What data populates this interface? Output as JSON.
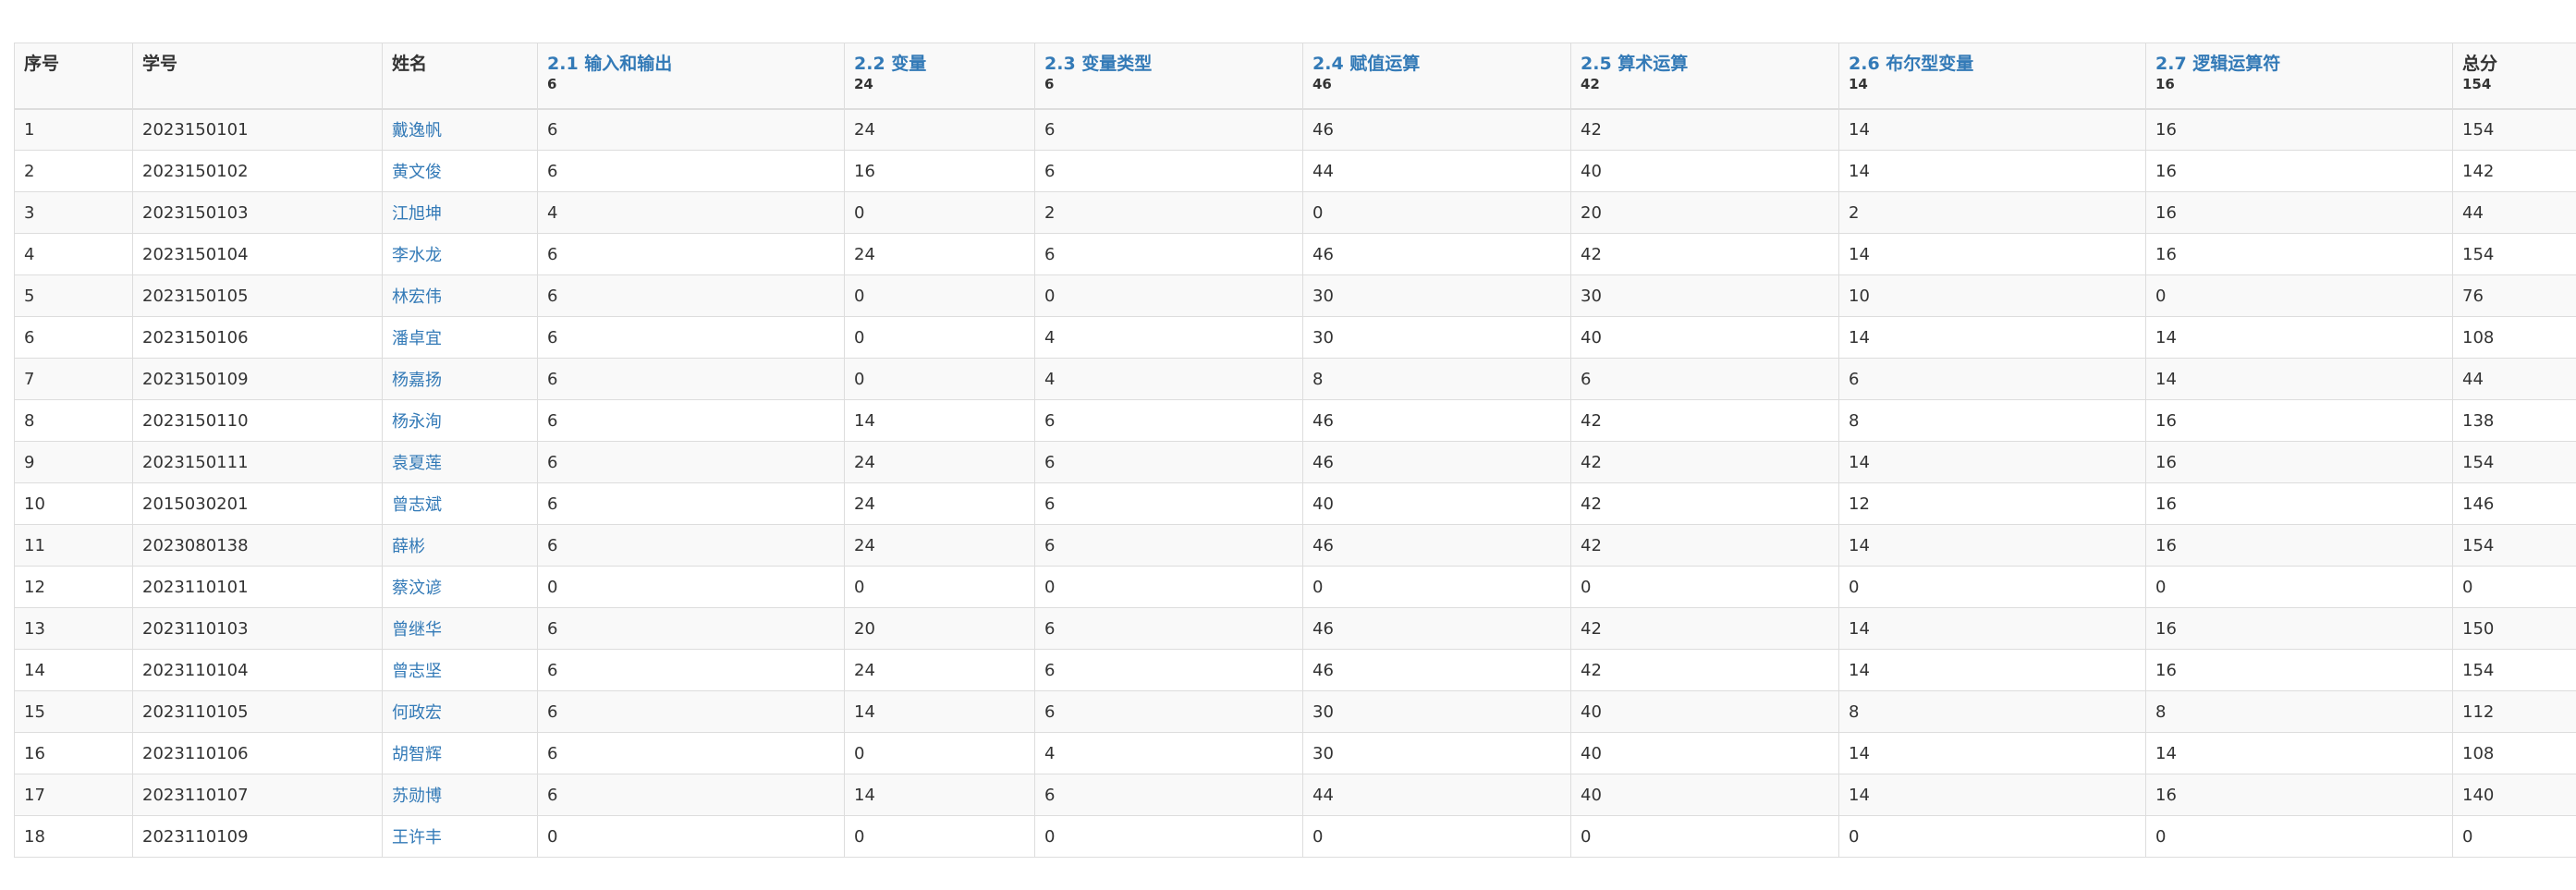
{
  "table": {
    "headers": {
      "seq": "序号",
      "student_id": "学号",
      "name": "姓名",
      "total": "总分",
      "total_max": "154"
    },
    "topics": [
      {
        "title": "2.1 输入和输出",
        "max": "6"
      },
      {
        "title": "2.2 变量",
        "max": "24"
      },
      {
        "title": "2.3 变量类型",
        "max": "6"
      },
      {
        "title": "2.4 赋值运算",
        "max": "46"
      },
      {
        "title": "2.5 算术运算",
        "max": "42"
      },
      {
        "title": "2.6 布尔型变量",
        "max": "14"
      },
      {
        "title": "2.7 逻辑运算符",
        "max": "16"
      }
    ],
    "rows": [
      {
        "seq": "1",
        "id": "2023150101",
        "name": "戴逸帆",
        "scores": [
          "6",
          "24",
          "6",
          "46",
          "42",
          "14",
          "16"
        ],
        "total": "154"
      },
      {
        "seq": "2",
        "id": "2023150102",
        "name": "黄文俊",
        "scores": [
          "6",
          "16",
          "6",
          "44",
          "40",
          "14",
          "16"
        ],
        "total": "142"
      },
      {
        "seq": "3",
        "id": "2023150103",
        "name": "江旭坤",
        "scores": [
          "4",
          "0",
          "2",
          "0",
          "20",
          "2",
          "16"
        ],
        "total": "44"
      },
      {
        "seq": "4",
        "id": "2023150104",
        "name": "李水龙",
        "scores": [
          "6",
          "24",
          "6",
          "46",
          "42",
          "14",
          "16"
        ],
        "total": "154"
      },
      {
        "seq": "5",
        "id": "2023150105",
        "name": "林宏伟",
        "scores": [
          "6",
          "0",
          "0",
          "30",
          "30",
          "10",
          "0"
        ],
        "total": "76"
      },
      {
        "seq": "6",
        "id": "2023150106",
        "name": "潘卓宜",
        "scores": [
          "6",
          "0",
          "4",
          "30",
          "40",
          "14",
          "14"
        ],
        "total": "108"
      },
      {
        "seq": "7",
        "id": "2023150109",
        "name": "杨嘉扬",
        "scores": [
          "6",
          "0",
          "4",
          "8",
          "6",
          "6",
          "14"
        ],
        "total": "44"
      },
      {
        "seq": "8",
        "id": "2023150110",
        "name": "杨永洵",
        "scores": [
          "6",
          "14",
          "6",
          "46",
          "42",
          "8",
          "16"
        ],
        "total": "138"
      },
      {
        "seq": "9",
        "id": "2023150111",
        "name": "袁夏莲",
        "scores": [
          "6",
          "24",
          "6",
          "46",
          "42",
          "14",
          "16"
        ],
        "total": "154"
      },
      {
        "seq": "10",
        "id": "2015030201",
        "name": "曾志斌",
        "scores": [
          "6",
          "24",
          "6",
          "40",
          "42",
          "12",
          "16"
        ],
        "total": "146"
      },
      {
        "seq": "11",
        "id": "2023080138",
        "name": "薛彬",
        "scores": [
          "6",
          "24",
          "6",
          "46",
          "42",
          "14",
          "16"
        ],
        "total": "154"
      },
      {
        "seq": "12",
        "id": "2023110101",
        "name": "蔡汶谚",
        "scores": [
          "0",
          "0",
          "0",
          "0",
          "0",
          "0",
          "0"
        ],
        "total": "0"
      },
      {
        "seq": "13",
        "id": "2023110103",
        "name": "曾继华",
        "scores": [
          "6",
          "20",
          "6",
          "46",
          "42",
          "14",
          "16"
        ],
        "total": "150"
      },
      {
        "seq": "14",
        "id": "2023110104",
        "name": "曾志坚",
        "scores": [
          "6",
          "24",
          "6",
          "46",
          "42",
          "14",
          "16"
        ],
        "total": "154"
      },
      {
        "seq": "15",
        "id": "2023110105",
        "name": "何政宏",
        "scores": [
          "6",
          "14",
          "6",
          "30",
          "40",
          "8",
          "8"
        ],
        "total": "112"
      },
      {
        "seq": "16",
        "id": "2023110106",
        "name": "胡智辉",
        "scores": [
          "6",
          "0",
          "4",
          "30",
          "40",
          "14",
          "14"
        ],
        "total": "108"
      },
      {
        "seq": "17",
        "id": "2023110107",
        "name": "苏勋博",
        "scores": [
          "6",
          "14",
          "6",
          "44",
          "40",
          "14",
          "16"
        ],
        "total": "140"
      },
      {
        "seq": "18",
        "id": "2023110109",
        "name": "王许丰",
        "scores": [
          "0",
          "0",
          "0",
          "0",
          "0",
          "0",
          "0"
        ],
        "total": "0"
      }
    ]
  },
  "colors": {
    "link": "#337ab7",
    "stripe": "#f9f9f9",
    "border": "#dddddd",
    "text": "#333333"
  }
}
